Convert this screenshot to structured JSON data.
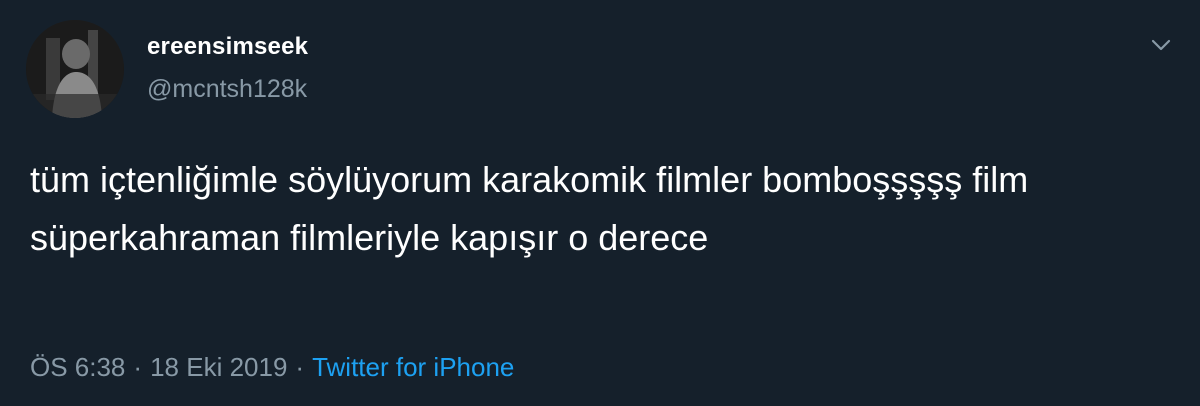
{
  "user": {
    "display_name": "ereensimseek",
    "handle": "@mcntsh128k"
  },
  "tweet": {
    "text": "tüm içtenliğimle söylüyorum karakomik filmler bomboşşşşş film süperkahraman filmleriyle kapışır o derece",
    "time": "ÖS 6:38",
    "date": "18 Eki 2019",
    "separator": "·",
    "source": "Twitter for iPhone"
  },
  "icons": {
    "menu": "chevron-down-icon"
  },
  "colors": {
    "background": "#15202b",
    "text": "#ffffff",
    "secondary": "#8899a6",
    "link": "#1da1f2"
  }
}
